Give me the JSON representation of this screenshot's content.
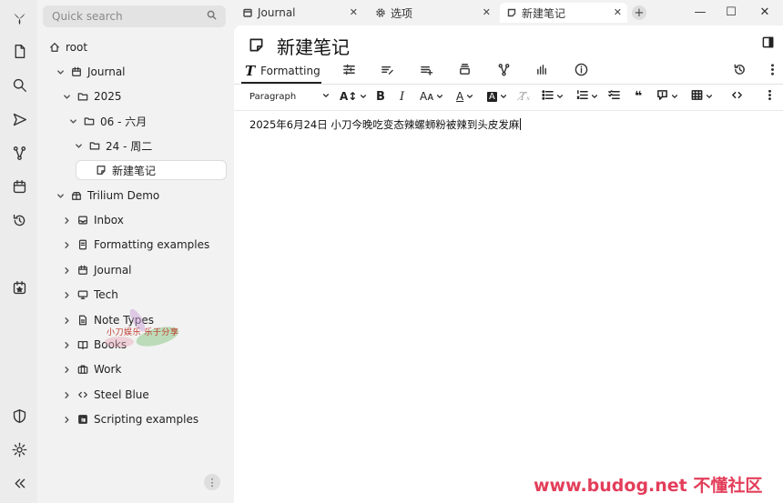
{
  "search": {
    "placeholder": "Quick search"
  },
  "tree": [
    {
      "label": "root",
      "icon": "home-icon"
    },
    {
      "label": "Journal",
      "icon": "calendar-icon"
    },
    {
      "label": "2025",
      "icon": "folder-icon"
    },
    {
      "label": "06 - 六月",
      "icon": "folder-icon"
    },
    {
      "label": "24 - 周二",
      "icon": "folder-icon"
    },
    {
      "label": "新建笔记",
      "icon": "note-icon"
    },
    {
      "label": "Trilium Demo",
      "icon": "package-icon"
    },
    {
      "label": "Inbox",
      "icon": "inbox-icon"
    },
    {
      "label": "Formatting examples",
      "icon": "document-icon"
    },
    {
      "label": "Journal",
      "icon": "calendar-icon"
    },
    {
      "label": "Tech",
      "icon": "monitor-icon"
    },
    {
      "label": "Note Types",
      "icon": "document-icon"
    },
    {
      "label": "Books",
      "icon": "book-icon"
    },
    {
      "label": "Work",
      "icon": "briefcase-icon"
    },
    {
      "label": "Steel Blue",
      "icon": "code-icon"
    },
    {
      "label": "Scripting examples",
      "icon": "js-icon"
    }
  ],
  "tabs": [
    {
      "label": "Journal",
      "icon": "calendar-icon"
    },
    {
      "label": "选项",
      "icon": "gear-icon"
    },
    {
      "label": "新建笔记",
      "icon": "note-icon"
    }
  ],
  "note": {
    "title": "新建笔记",
    "content": "2025年6月24日 小刀今晚吃变态辣螺蛳粉被辣到头皮发麻"
  },
  "ribbon": {
    "formatting_label": "Formatting"
  },
  "toolbar": {
    "block_type": "Paragraph"
  },
  "watermark": {
    "sticker_text": "小刀娱乐 乐于分享",
    "site_text": "www.budog.net 不懂社区"
  },
  "colors": {
    "accent": "#222222",
    "watermark": "#e33e5a",
    "bg": "#f2f2f2"
  }
}
